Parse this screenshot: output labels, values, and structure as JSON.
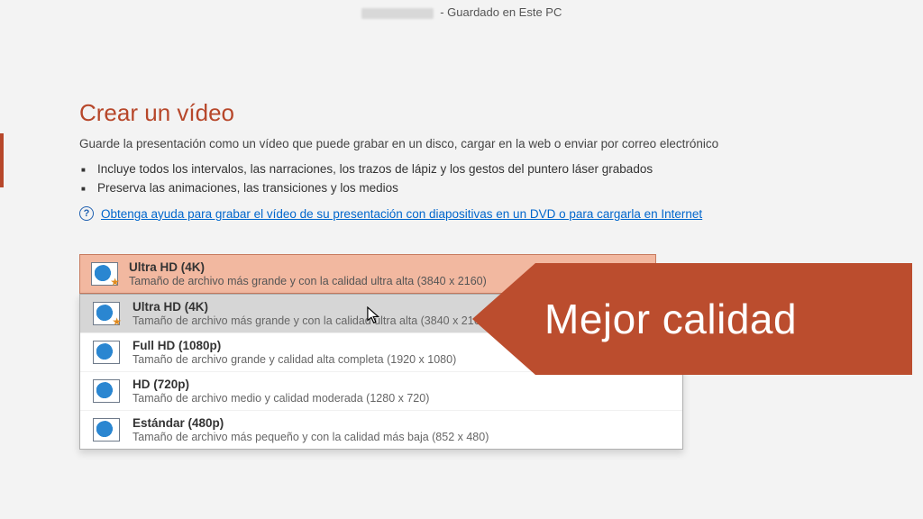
{
  "titlebar": {
    "suffix": " -  Guardado en Este PC"
  },
  "page": {
    "heading": "Crear un vídeo",
    "lead": "Guarde la presentación como un vídeo que puede grabar en un disco, cargar en la web o enviar por correo electrónico",
    "bullets": [
      "Incluye todos los intervalos, las narraciones, los trazos de lápiz y los gestos del puntero láser grabados",
      "Preserva las animaciones, las transiciones y los medios"
    ],
    "help_link": "Obtenga ayuda para grabar el vídeo de su presentación con diapositivas en un DVD o para cargarla en Internet"
  },
  "quality": {
    "selected": {
      "title": "Ultra HD (4K)",
      "desc": "Tamaño de archivo más grande y con la calidad ultra alta (3840 x 2160)"
    },
    "options": [
      {
        "title": "Ultra HD (4K)",
        "desc": "Tamaño de archivo más grande y con la calidad ultra alta (3840 x 2160)"
      },
      {
        "title": "Full HD (1080p)",
        "desc": "Tamaño de archivo grande y calidad alta completa (1920 x 1080)"
      },
      {
        "title": "HD (720p)",
        "desc": "Tamaño de archivo medio y calidad moderada (1280 x 720)"
      },
      {
        "title": "Estándar (480p)",
        "desc": "Tamaño de archivo más pequeño y con la calidad más baja (852 x 480)"
      }
    ]
  },
  "callout": {
    "text": "Mejor calidad"
  },
  "colors": {
    "accent": "#b7472a",
    "callout": "#bb4d2e"
  }
}
